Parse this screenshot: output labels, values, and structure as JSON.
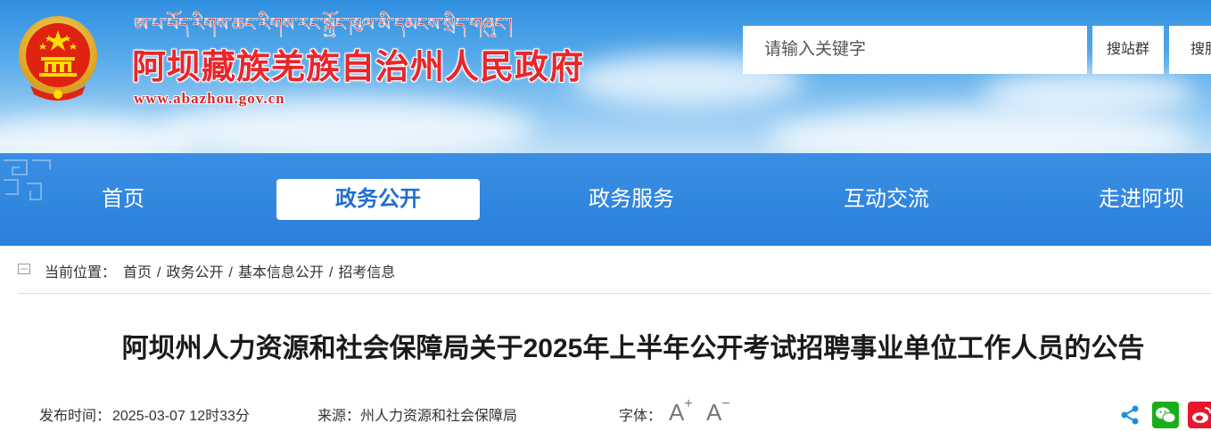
{
  "header": {
    "tibetan_text": "ཨ་པ་བོད་རིགས་ཆང་རིགས་རང་སྐྱོང་ཁུལ་མི་དམངས་སྲིད་གཞུང་།",
    "site_title": "阿坝藏族羌族自治州人民政府",
    "site_url": "www.abazhou.gov.cn",
    "search": {
      "placeholder": "请输入关键字",
      "btn_station_group": "搜站群",
      "btn_this_site": "搜服"
    }
  },
  "nav": {
    "items": [
      {
        "label": "首页",
        "active": false
      },
      {
        "label": "政务公开",
        "active": true
      },
      {
        "label": "政务服务",
        "active": false
      },
      {
        "label": "互动交流",
        "active": false
      },
      {
        "label": "走进阿坝",
        "active": false
      }
    ]
  },
  "breadcrumb": {
    "label": "当前位置：",
    "path": [
      "首页",
      "政务公开",
      "基本信息公开",
      "招考信息"
    ],
    "separator": "/"
  },
  "article": {
    "title": "阿坝州人力资源和社会保障局关于2025年上半年公开考试招聘事业单位工作人员的公告",
    "publish_label": "发布时间：",
    "publish_time": "2025-03-07 12时33分",
    "source_label": "来源：",
    "source": "州人力资源和社会保障局",
    "font_label": "字体：",
    "font_increase": "A",
    "font_decrease": "A"
  },
  "icons": [
    "national-emblem-icon",
    "share-icon",
    "wechat-icon",
    "weibo-icon"
  ],
  "colors": {
    "nav_bg": "#2a7fdb",
    "title_red": "#e9262b",
    "active_nav_text": "#1f6fd1",
    "wechat_green": "#1aad19",
    "weibo_red": "#e6162d",
    "share_blue": "#1e8fe1"
  }
}
